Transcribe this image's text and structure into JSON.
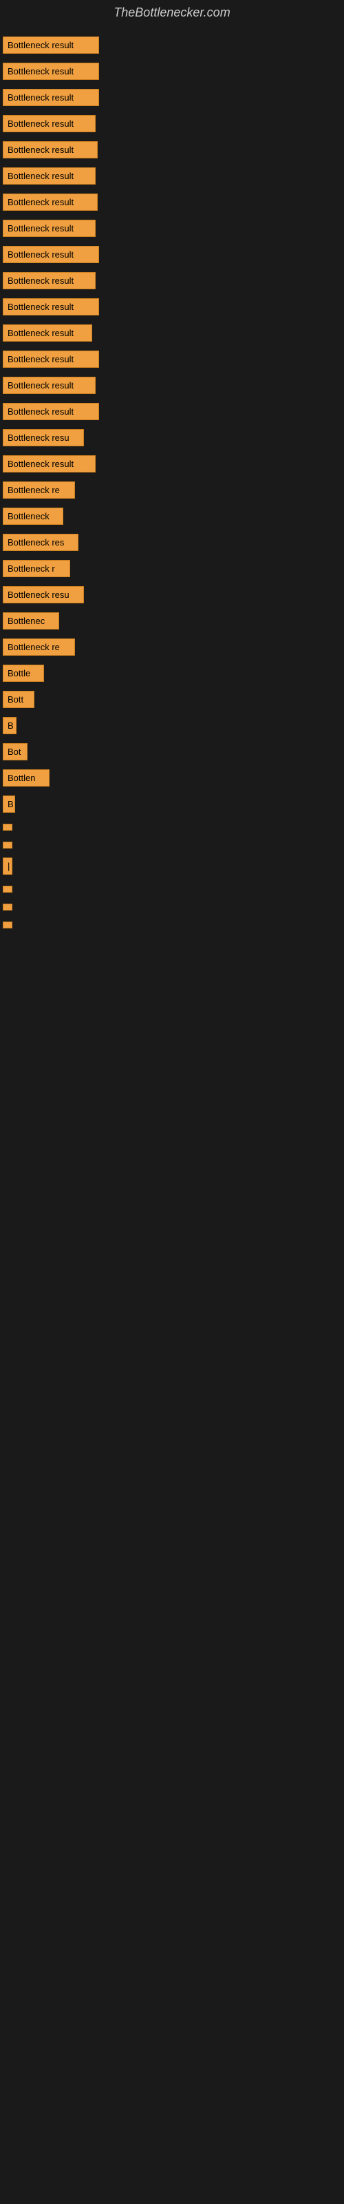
{
  "site": {
    "title": "TheBottlenecker.com"
  },
  "bars": [
    {
      "label": "Bottleneck result",
      "width": 140
    },
    {
      "label": "Bottleneck result",
      "width": 140
    },
    {
      "label": "Bottleneck result",
      "width": 140
    },
    {
      "label": "Bottleneck result",
      "width": 135
    },
    {
      "label": "Bottleneck result",
      "width": 138
    },
    {
      "label": "Bottleneck result",
      "width": 135
    },
    {
      "label": "Bottleneck result",
      "width": 138
    },
    {
      "label": "Bottleneck result",
      "width": 135
    },
    {
      "label": "Bottleneck result",
      "width": 140
    },
    {
      "label": "Bottleneck result",
      "width": 135
    },
    {
      "label": "Bottleneck result",
      "width": 140
    },
    {
      "label": "Bottleneck result",
      "width": 130
    },
    {
      "label": "Bottleneck result",
      "width": 140
    },
    {
      "label": "Bottleneck result",
      "width": 135
    },
    {
      "label": "Bottleneck result",
      "width": 140
    },
    {
      "label": "Bottleneck resu",
      "width": 118
    },
    {
      "label": "Bottleneck result",
      "width": 135
    },
    {
      "label": "Bottleneck re",
      "width": 105
    },
    {
      "label": "Bottleneck",
      "width": 88
    },
    {
      "label": "Bottleneck res",
      "width": 110
    },
    {
      "label": "Bottleneck r",
      "width": 98
    },
    {
      "label": "Bottleneck resu",
      "width": 118
    },
    {
      "label": "Bottlenec",
      "width": 82
    },
    {
      "label": "Bottleneck re",
      "width": 105
    },
    {
      "label": "Bottle",
      "width": 60
    },
    {
      "label": "Bott",
      "width": 46
    },
    {
      "label": "B",
      "width": 20
    },
    {
      "label": "Bot",
      "width": 36
    },
    {
      "label": "Bottlen",
      "width": 68
    },
    {
      "label": "B",
      "width": 18
    },
    {
      "label": "",
      "width": 8
    },
    {
      "label": "",
      "width": 6
    },
    {
      "label": "|",
      "width": 10
    },
    {
      "label": "",
      "width": 8
    },
    {
      "label": "",
      "width": 6
    },
    {
      "label": "",
      "width": 5
    }
  ]
}
